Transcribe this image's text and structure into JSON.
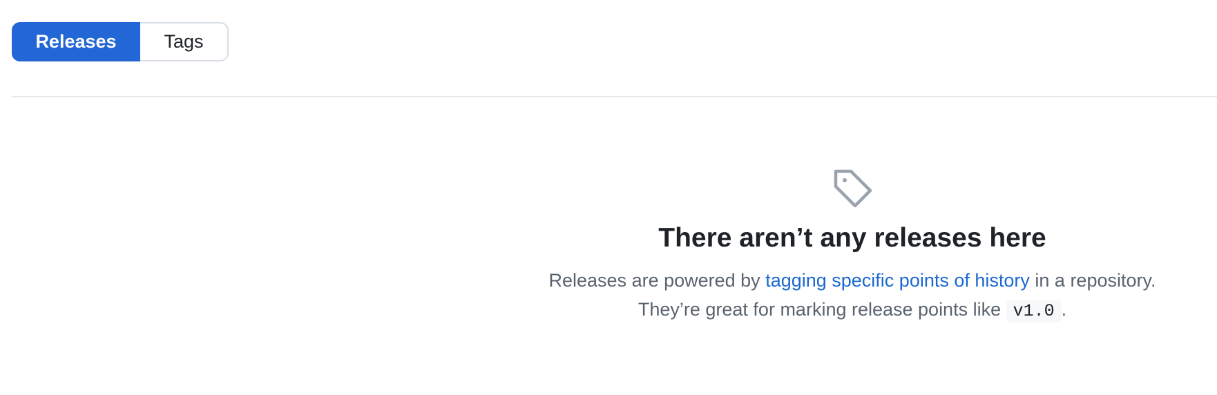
{
  "tabs": {
    "releases": "Releases",
    "tags": "Tags"
  },
  "blankslate": {
    "icon": "tag-icon",
    "title": "There aren’t any releases here",
    "line1_prefix": "Releases are powered by ",
    "line1_link": "tagging specific points of history",
    "line1_suffix": " in a repository.",
    "line2_prefix": "They’re great for marking release points like ",
    "line2_code": "v1.0",
    "line2_suffix": "."
  },
  "colors": {
    "accent": "#2367d6",
    "link": "#1a68d2",
    "muted_text": "#59636e",
    "icon": "#9aa3ad"
  }
}
